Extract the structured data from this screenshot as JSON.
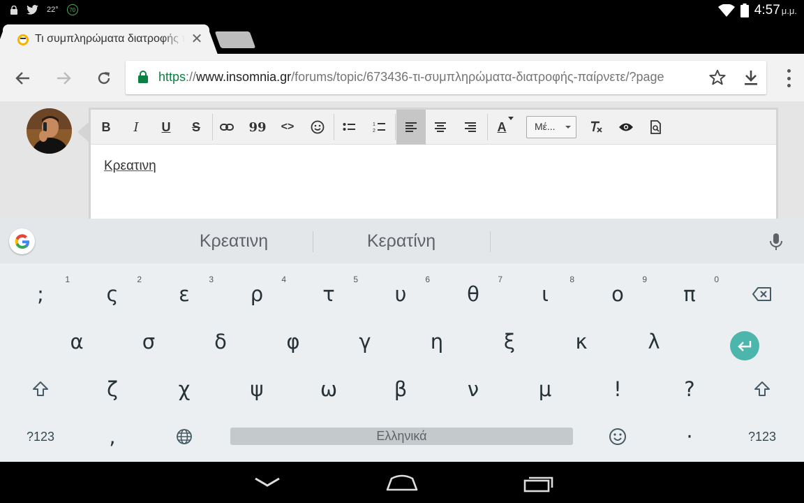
{
  "status_bar": {
    "temperature": "22°",
    "badge": "70",
    "time": "4:57",
    "ampm": "μ.μ."
  },
  "tab": {
    "title": "Τι συμπληρώματα διατροφής παίρνετε",
    "close_glyph": "✕"
  },
  "address_bar": {
    "url_scheme": "https",
    "url_sep": "://",
    "url_host": "www.insomnia.gr",
    "url_path": "/forums/topic/673436-τι-συμπληρώματα-διατροφής-παίρνετε/?page"
  },
  "editor": {
    "format_select": "Μέ...",
    "text": "Κρεατινη",
    "toolbar": {
      "bold": "B",
      "italic": "I",
      "underline": "U",
      "strike": "S",
      "quote": "99",
      "code": "<>",
      "font_color": "A"
    }
  },
  "keyboard": {
    "suggestions": [
      "Κρεατινη",
      "Κερατίνη"
    ],
    "row1": [
      {
        "key": ";",
        "hint": "1"
      },
      {
        "key": "ς",
        "hint": "2"
      },
      {
        "key": "ε",
        "hint": "3"
      },
      {
        "key": "ρ",
        "hint": "4"
      },
      {
        "key": "τ",
        "hint": "5"
      },
      {
        "key": "υ",
        "hint": "6"
      },
      {
        "key": "θ",
        "hint": "7"
      },
      {
        "key": "ι",
        "hint": "8"
      },
      {
        "key": "ο",
        "hint": "9"
      },
      {
        "key": "π",
        "hint": "0"
      }
    ],
    "row2": [
      "α",
      "σ",
      "δ",
      "φ",
      "γ",
      "η",
      "ξ",
      "κ",
      "λ"
    ],
    "row3": [
      "ζ",
      "χ",
      "ψ",
      "ω",
      "β",
      "ν",
      "μ",
      "!",
      "?"
    ],
    "symbols_label": "?123",
    "comma": ",",
    "space_label": "Ελληνικά",
    "period": "·"
  }
}
